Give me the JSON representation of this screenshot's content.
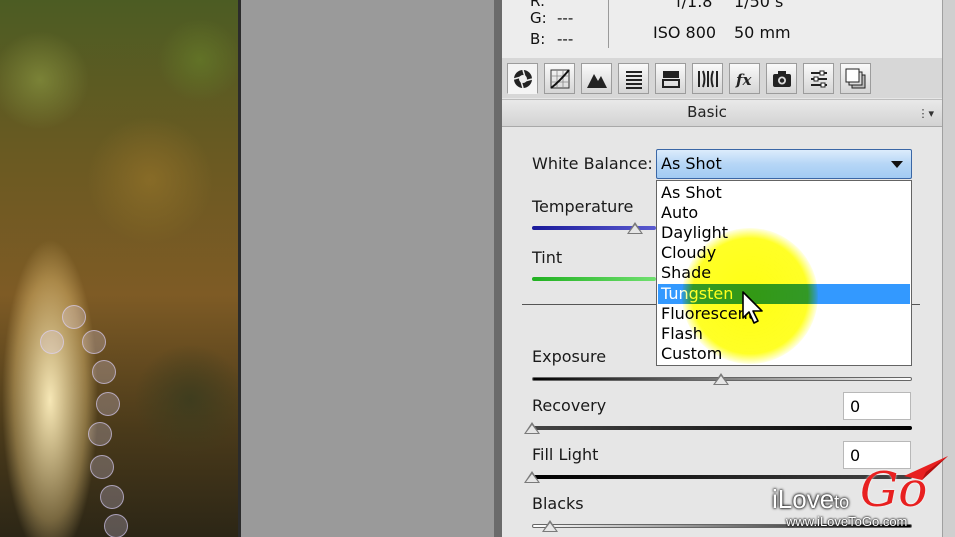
{
  "info": {
    "g_label": "G:",
    "g_value": "---",
    "b_label": "B:",
    "b_value": "---",
    "aperture": "f/1.8",
    "shutter": "1/50 s",
    "iso": "ISO 800",
    "focal": "50 mm"
  },
  "section": {
    "title": "Basic"
  },
  "white_balance": {
    "label": "White Balance:",
    "value": "As Shot",
    "options": [
      "As Shot",
      "Auto",
      "Daylight",
      "Cloudy",
      "Shade",
      "Tungsten",
      "Fluorescent",
      "Flash",
      "Custom"
    ],
    "highlighted": "Tungsten"
  },
  "sliders": {
    "temperature": {
      "label": "Temperature"
    },
    "tint": {
      "label": "Tint"
    },
    "exposure": {
      "label": "Exposure"
    },
    "recovery": {
      "label": "Recovery",
      "value": "0"
    },
    "fill_light": {
      "label": "Fill Light",
      "value": "0"
    },
    "blacks": {
      "label": "Blacks"
    }
  },
  "watermark": {
    "brand_prefix": "iLove",
    "brand_to": "to",
    "brand_go": "Go",
    "url": "www.iLoveToGo.com"
  },
  "icons": [
    "aperture-icon",
    "tone-curve-icon",
    "detail-icon",
    "hsl-icon",
    "split-tone-icon",
    "lens-icon",
    "fx-icon",
    "camera-icon",
    "presets-icon",
    "snapshots-icon"
  ],
  "colors": {
    "highlight": "#3399ff",
    "annotation": "#ffff00",
    "brand_red": "#e82020"
  }
}
